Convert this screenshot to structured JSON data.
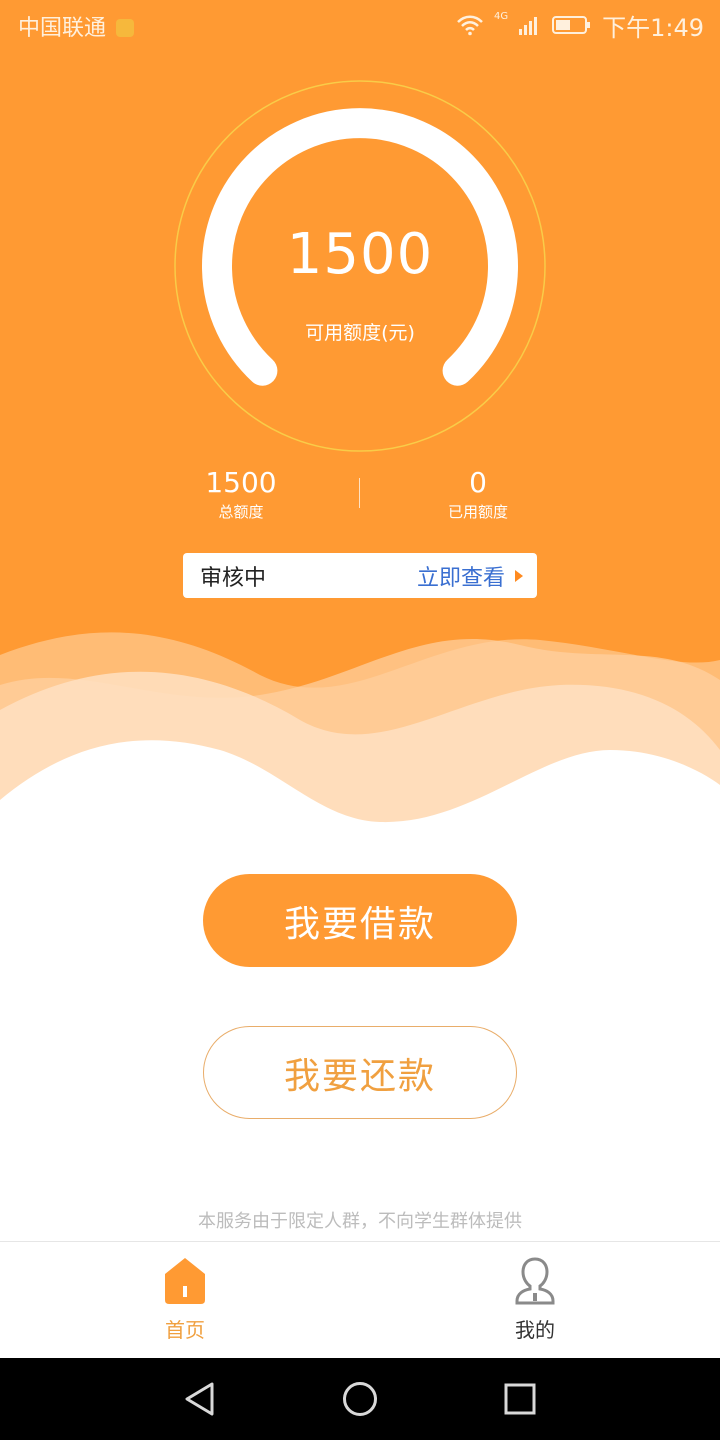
{
  "status_bar": {
    "carrier": "中国联通",
    "network": "4G",
    "time": "下午1:49",
    "icons": [
      "wifi-icon",
      "signal-icon",
      "battery-icon"
    ]
  },
  "credit": {
    "available_amount": "1500",
    "available_label": "可用额度(元)",
    "total_amount": "1500",
    "total_label": "总额度",
    "used_amount": "0",
    "used_label": "已用额度"
  },
  "review": {
    "status": "审核中",
    "link_label": "立即查看"
  },
  "actions": {
    "borrow_label": "我要借款",
    "repay_label": "我要还款"
  },
  "disclaimer": "本服务由于限定人群，不向学生群体提供",
  "tabs": [
    {
      "label": "首页",
      "icon": "home-icon",
      "active": true
    },
    {
      "label": "我的",
      "icon": "user-icon",
      "active": false
    }
  ],
  "nav": [
    "back-icon",
    "home-nav-icon",
    "recent-apps-icon"
  ],
  "colors": {
    "accent": "#ff9a33",
    "link": "#3a6fd1",
    "repay_text": "#f0a040",
    "tab_active": "#f0a040"
  }
}
